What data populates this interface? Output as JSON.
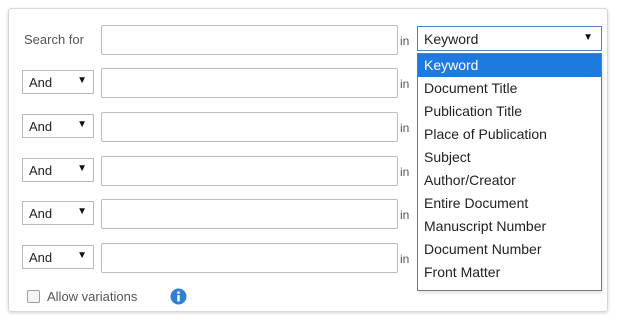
{
  "search": {
    "search_for_label": "Search for",
    "in_label": "in",
    "field_select": {
      "value": "Keyword"
    },
    "dropdown_options": [
      "Keyword",
      "Document Title",
      "Publication Title",
      "Place of Publication",
      "Subject",
      "Author/Creator",
      "Entire Document",
      "Manuscript Number",
      "Document Number",
      "Front Matter"
    ],
    "selected_option_index": 0,
    "rows": [
      {
        "operator": "And"
      },
      {
        "operator": "And"
      },
      {
        "operator": "And"
      },
      {
        "operator": "And"
      },
      {
        "operator": "And"
      }
    ]
  },
  "variations": {
    "label": "Allow variations",
    "checked": false
  },
  "icons": {
    "dropdown_arrow": "caret-down-icon",
    "info": "info-icon",
    "checkbox": "checkbox-unchecked-icon"
  },
  "colors": {
    "selected_option": "#1e7adf",
    "focus_border": "#4f82c6",
    "info_icon": "#2f7fd3"
  }
}
